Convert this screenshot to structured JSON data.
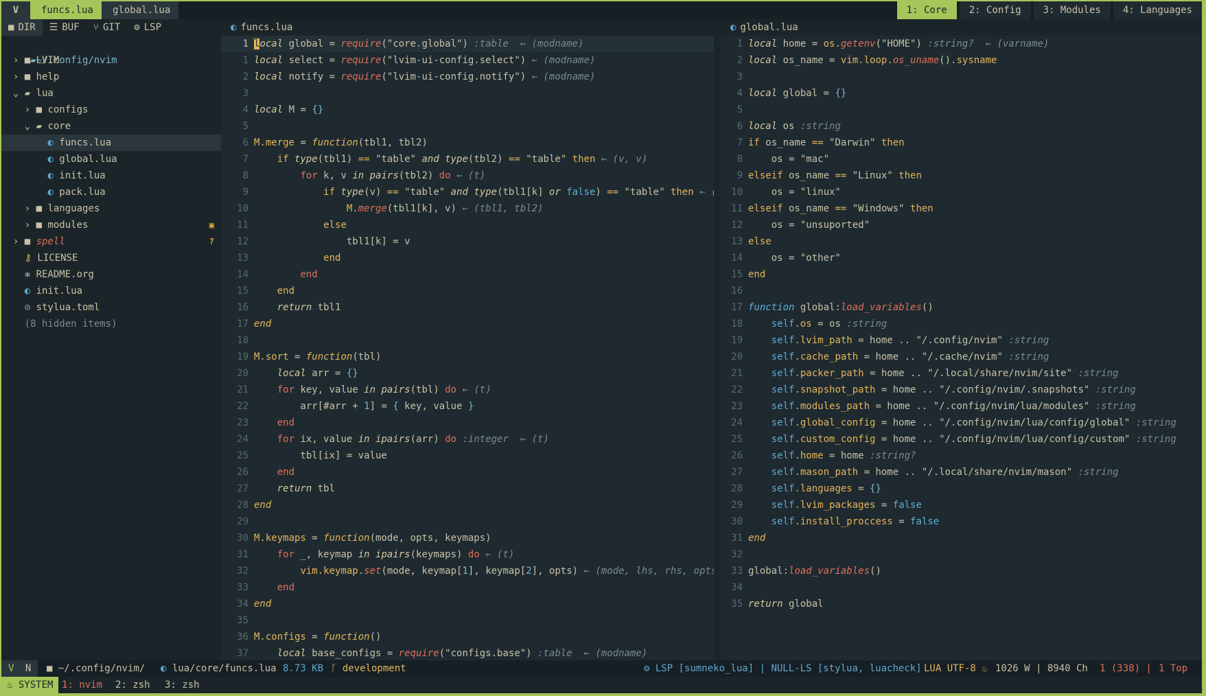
{
  "tabline": {
    "logo": "V",
    "buffers": [
      {
        "label": "funcs.lua",
        "active": true
      },
      {
        "label": "global.lua",
        "active": false
      }
    ],
    "workspaces": [
      {
        "label": "1: Core",
        "active": true
      },
      {
        "label": "2: Config",
        "active": false
      },
      {
        "label": "3: Modules",
        "active": false
      },
      {
        "label": "4: Languages",
        "active": false
      }
    ]
  },
  "sidebar": {
    "tabs": [
      {
        "icon": "folder-icon",
        "label": "DIR"
      },
      {
        "icon": "list-icon",
        "label": "BUF"
      },
      {
        "icon": "git-icon",
        "label": "GIT"
      },
      {
        "icon": "gears-icon",
        "label": "LSP"
      }
    ],
    "root": "~/.config/nvim",
    "tree": [
      {
        "indent": 0,
        "arrow": "›",
        "icon": "folder",
        "label": "LVIM"
      },
      {
        "indent": 0,
        "arrow": "›",
        "icon": "folder",
        "label": "help"
      },
      {
        "indent": 0,
        "arrow": "⌄",
        "icon": "folder-open",
        "label": "lua"
      },
      {
        "indent": 1,
        "arrow": "›",
        "icon": "folder",
        "label": "configs"
      },
      {
        "indent": 1,
        "arrow": "⌄",
        "icon": "folder-open",
        "label": "core"
      },
      {
        "indent": 2,
        "arrow": "",
        "icon": "lua",
        "label": "funcs.lua",
        "selected": true
      },
      {
        "indent": 2,
        "arrow": "",
        "icon": "lua",
        "label": "global.lua"
      },
      {
        "indent": 2,
        "arrow": "",
        "icon": "lua",
        "label": "init.lua"
      },
      {
        "indent": 2,
        "arrow": "",
        "icon": "lua",
        "label": "pack.lua"
      },
      {
        "indent": 1,
        "arrow": "›",
        "icon": "folder",
        "label": "languages"
      },
      {
        "indent": 1,
        "arrow": "›",
        "icon": "folder",
        "label": "modules",
        "badge": "▣"
      },
      {
        "indent": 0,
        "arrow": "›",
        "icon": "folder",
        "label": "spell",
        "italic": true,
        "badge": "?"
      },
      {
        "indent": 0,
        "arrow": "",
        "icon": "key",
        "label": "LICENSE"
      },
      {
        "indent": 0,
        "arrow": "",
        "icon": "star",
        "label": "README.org"
      },
      {
        "indent": 0,
        "arrow": "",
        "icon": "lua",
        "label": "init.lua"
      },
      {
        "indent": 0,
        "arrow": "",
        "icon": "gear",
        "label": "stylua.toml"
      },
      {
        "indent": 0,
        "arrow": "",
        "icon": "none",
        "label": "(8 hidden items)",
        "dim": true
      }
    ]
  },
  "left_pane": {
    "filename": "funcs.lua",
    "lines": [
      {
        "n": "1",
        "cur": true,
        "html": "<span class='cursor'>l</span><span class='loc'>ocal</span> global = <span class='fn'>require</span>(\"core.global\") <span class='hint'>:table  ← (modname)</span>"
      },
      {
        "n": "1",
        "html": "<span class='loc'>local</span> select = <span class='fn'>require</span>(\"lvim-ui-config.select\") <span class='hint'>← (modname)</span>"
      },
      {
        "n": "2",
        "html": "<span class='loc'>local</span> notify = <span class='fn'>require</span>(\"lvim-ui-config.notify\") <span class='hint'>← (modname)</span>"
      },
      {
        "n": "3",
        "html": ""
      },
      {
        "n": "4",
        "html": "<span class='loc'>local</span> M = <span class='num'>{}</span>"
      },
      {
        "n": "5",
        "html": ""
      },
      {
        "n": "6",
        "html": "<span class='field'>M.merge</span> = <span class='kwi'>function</span>(tbl1, tbl2)"
      },
      {
        "n": "7",
        "html": "    <span class='kw'>if</span> <span class='loc'>type</span>(tbl1) <span class='op'>==</span> \"table\" <span class='loc'>and</span> <span class='loc'>type</span>(tbl2) <span class='op'>==</span> \"table\" <span class='kw'>then</span> <span class='hint'>← (v, v)</span>"
      },
      {
        "n": "8",
        "html": "        <span class='fnk'>for</span> k, v <span class='loc'>in</span> <span class='loc'>pairs</span>(tbl2) <span class='fnk'>do</span> <span class='hint'>← (t)</span>"
      },
      {
        "n": "9",
        "html": "            <span class='kw'>if</span> <span class='loc'>type</span>(v) <span class='op'>==</span> \"table\" <span class='loc'>and</span> <span class='loc'>type</span>(tbl1[k] <span class='loc'>or</span> <span class='bool'>false</span>) <span class='op'>==</span> \"table\" <span class='kw'>then</span> <span class='hint'>← (v,</span>"
      },
      {
        "n": "10",
        "html": "                <span class='field'>M.</span><span class='fn'>merge</span>(tbl1[k], v) <span class='hint'>← (tbl1, tbl2)</span>"
      },
      {
        "n": "11",
        "html": "            <span class='kw'>else</span>"
      },
      {
        "n": "12",
        "html": "                tbl1[k] = v"
      },
      {
        "n": "13",
        "html": "            <span class='kw'>end</span>"
      },
      {
        "n": "14",
        "html": "        <span class='fnk'>end</span>"
      },
      {
        "n": "15",
        "html": "    <span class='kw'>end</span>"
      },
      {
        "n": "16",
        "html": "    <span class='loc'>return</span> tbl1"
      },
      {
        "n": "17",
        "html": "<span class='kwi'>end</span>"
      },
      {
        "n": "18",
        "html": ""
      },
      {
        "n": "19",
        "html": "<span class='field'>M.sort</span> = <span class='kwi'>function</span>(tbl)"
      },
      {
        "n": "20",
        "html": "    <span class='loc'>local</span> arr = <span class='num'>{}</span>"
      },
      {
        "n": "21",
        "html": "    <span class='fnk'>for</span> key, value <span class='loc'>in</span> <span class='loc'>pairs</span>(tbl) <span class='fnk'>do</span> <span class='hint'>← (t)</span>"
      },
      {
        "n": "22",
        "html": "        arr[#arr + <span class='num'>1</span>] = <span class='num'>{</span> key, value <span class='num'>}</span>"
      },
      {
        "n": "23",
        "html": "    <span class='fnk'>end</span>"
      },
      {
        "n": "24",
        "html": "    <span class='fnk'>for</span> ix, value <span class='loc'>in</span> <span class='loc'>ipairs</span>(arr) <span class='fnk'>do</span> <span class='hint'>:integer  ← (t)</span>"
      },
      {
        "n": "25",
        "html": "        tbl[ix] = value"
      },
      {
        "n": "26",
        "html": "    <span class='fnk'>end</span>"
      },
      {
        "n": "27",
        "html": "    <span class='loc'>return</span> tbl"
      },
      {
        "n": "28",
        "html": "<span class='kwi'>end</span>"
      },
      {
        "n": "29",
        "html": ""
      },
      {
        "n": "30",
        "html": "<span class='field'>M.keymaps</span> = <span class='kwi'>function</span>(mode, opts, keymaps)"
      },
      {
        "n": "31",
        "html": "    <span class='fnk'>for</span> _, keymap <span class='loc'>in</span> <span class='loc'>ipairs</span>(keymaps) <span class='fnk'>do</span> <span class='hint'>← (t)</span>"
      },
      {
        "n": "32",
        "html": "        <span class='field'>vim.keymap.</span><span class='fn'>set</span>(mode, keymap[<span class='num'>1</span>], keymap[<span class='num'>2</span>], opts) <span class='hint'>← (mode, lhs, rhs, opts)</span>"
      },
      {
        "n": "33",
        "html": "    <span class='fnk'>end</span>"
      },
      {
        "n": "34",
        "html": "<span class='kwi'>end</span>"
      },
      {
        "n": "35",
        "html": ""
      },
      {
        "n": "36",
        "html": "<span class='field'>M.configs</span> = <span class='kwi'>function</span>()"
      },
      {
        "n": "37",
        "html": "    <span class='loc'>local</span> base_configs = <span class='fn'>require</span>(\"configs.base\") <span class='hint'>:table  ← (modname)</span>"
      }
    ]
  },
  "right_pane": {
    "filename": "global.lua",
    "lines": [
      {
        "n": "1",
        "html": "<span class='loc'>local</span> home = <span class='field'>os.</span><span class='fn'>getenv</span>(\"HOME\") <span class='hint'>:string?  ← (varname)</span>"
      },
      {
        "n": "2",
        "html": "<span class='loc'>local</span> os_name = <span class='field'>vim.loop.</span><span class='fn'>os_uname</span>()<span class='field'>.sysname</span>"
      },
      {
        "n": "3",
        "html": ""
      },
      {
        "n": "4",
        "html": "<span class='loc'>local</span> global = <span class='num'>{}</span>"
      },
      {
        "n": "5",
        "html": ""
      },
      {
        "n": "6",
        "html": "<span class='loc'>local</span> os <span class='hint'>:string</span>"
      },
      {
        "n": "7",
        "html": "<span class='kw'>if</span> os_name <span class='op'>==</span> \"Darwin\" <span class='kw'>then</span>"
      },
      {
        "n": "8",
        "html": "    os = \"mac\""
      },
      {
        "n": "9",
        "html": "<span class='kw'>elseif</span> os_name <span class='op'>==</span> \"Linux\" <span class='kw'>then</span>"
      },
      {
        "n": "10",
        "html": "    os = \"linux\""
      },
      {
        "n": "11",
        "html": "<span class='kw'>elseif</span> os_name <span class='op'>==</span> \"Windows\" <span class='kw'>then</span>"
      },
      {
        "n": "12",
        "html": "    os = \"unsuported\""
      },
      {
        "n": "13",
        "html": "<span class='kw'>else</span>"
      },
      {
        "n": "14",
        "html": "    os = \"other\""
      },
      {
        "n": "15",
        "html": "<span class='kw'>end</span>"
      },
      {
        "n": "16",
        "html": ""
      },
      {
        "n": "17",
        "html": "<span class='bool' style='font-style:italic'>function</span> global:<span class='fn'>load_variables</span>()"
      },
      {
        "n": "18",
        "html": "    <span class='self'>self</span><span class='field'>.os</span> = os <span class='hint'>:string</span>"
      },
      {
        "n": "19",
        "html": "    <span class='self'>self</span><span class='field'>.lvim_path</span> = home .. \"/.config/nvim\" <span class='hint'>:string</span>"
      },
      {
        "n": "20",
        "html": "    <span class='self'>self</span><span class='field'>.cache_path</span> = home .. \"/.cache/nvim\" <span class='hint'>:string</span>"
      },
      {
        "n": "21",
        "html": "    <span class='self'>self</span><span class='field'>.packer_path</span> = home .. \"/.local/share/nvim/site\" <span class='hint'>:string</span>"
      },
      {
        "n": "22",
        "html": "    <span class='self'>self</span><span class='field'>.snapshot_path</span> = home .. \"/.config/nvim/.snapshots\" <span class='hint'>:string</span>"
      },
      {
        "n": "23",
        "html": "    <span class='self'>self</span><span class='field'>.modules_path</span> = home .. \"/.config/nvim/lua/modules\" <span class='hint'>:string</span>"
      },
      {
        "n": "24",
        "html": "    <span class='self'>self</span><span class='field'>.global_config</span> = home .. \"/.config/nvim/lua/config/global\" <span class='hint'>:string</span>"
      },
      {
        "n": "25",
        "html": "    <span class='self'>self</span><span class='field'>.custom_config</span> = home .. \"/.config/nvim/lua/config/custom\" <span class='hint'>:string</span>"
      },
      {
        "n": "26",
        "html": "    <span class='self'>self</span><span class='field'>.home</span> = home <span class='hint'>:string?</span>"
      },
      {
        "n": "27",
        "html": "    <span class='self'>self</span><span class='field'>.mason_path</span> = home .. \"/.local/share/nvim/mason\" <span class='hint'>:string</span>"
      },
      {
        "n": "28",
        "html": "    <span class='self'>self</span><span class='field'>.languages</span> = <span class='num'>{}</span>"
      },
      {
        "n": "29",
        "html": "    <span class='self'>self</span><span class='field'>.lvim_packages</span> = <span class='bool'>false</span>"
      },
      {
        "n": "30",
        "html": "    <span class='self'>self</span><span class='field'>.install_proccess</span> = <span class='bool'>false</span>"
      },
      {
        "n": "31",
        "html": "<span class='kwi'>end</span>"
      },
      {
        "n": "32",
        "html": ""
      },
      {
        "n": "33",
        "html": "global:<span class='fn'>load_variables</span>()"
      },
      {
        "n": "34",
        "html": ""
      },
      {
        "n": "35",
        "html": "<span class='loc'>return</span> global"
      }
    ]
  },
  "statusline": {
    "mode": "N",
    "cwd": "~/.config/nvim/",
    "file": "lua/core/funcs.lua",
    "size": "8.73 KB",
    "branch": "development",
    "lsp": "LSP [sumneko_lua] | NULL-LS [stylua, luacheck]",
    "filetype": "LUA UTF-8",
    "words": "1026 W | 8940 Ch",
    "position": "1 (338)  |",
    "scroll": "1 Top"
  },
  "tmux": {
    "session": "SYSTEM",
    "windows": [
      "1: nvim",
      "2: zsh",
      "3: zsh"
    ]
  },
  "colors": {
    "accent": "#a4c65a",
    "background": "#1e2a30",
    "keyword": "#e6b45a",
    "function": "#e06e5a",
    "number": "#7fb4ca"
  }
}
